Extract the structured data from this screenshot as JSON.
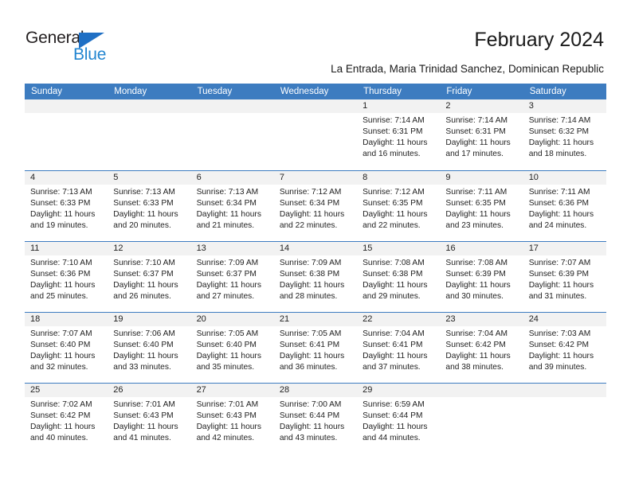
{
  "brand": {
    "name_top": "General",
    "name_bottom": "Blue",
    "accent_color": "#2285d0",
    "triangle_color": "#1f6fc4"
  },
  "header": {
    "title": "February 2024",
    "subtitle": "La Entrada, Maria Trinidad Sanchez, Dominican Republic"
  },
  "calendar": {
    "header_color": "#3d7cc0",
    "date_band_color": "#f2f2f2",
    "day_names": [
      "Sunday",
      "Monday",
      "Tuesday",
      "Wednesday",
      "Thursday",
      "Friday",
      "Saturday"
    ],
    "weeks": [
      [
        {
          "date": "",
          "empty": true
        },
        {
          "date": "",
          "empty": true
        },
        {
          "date": "",
          "empty": true
        },
        {
          "date": "",
          "empty": true
        },
        {
          "date": "1",
          "sunrise": "Sunrise: 7:14 AM",
          "sunset": "Sunset: 6:31 PM",
          "daylight_1": "Daylight: 11 hours",
          "daylight_2": "and 16 minutes."
        },
        {
          "date": "2",
          "sunrise": "Sunrise: 7:14 AM",
          "sunset": "Sunset: 6:31 PM",
          "daylight_1": "Daylight: 11 hours",
          "daylight_2": "and 17 minutes."
        },
        {
          "date": "3",
          "sunrise": "Sunrise: 7:14 AM",
          "sunset": "Sunset: 6:32 PM",
          "daylight_1": "Daylight: 11 hours",
          "daylight_2": "and 18 minutes."
        }
      ],
      [
        {
          "date": "4",
          "sunrise": "Sunrise: 7:13 AM",
          "sunset": "Sunset: 6:33 PM",
          "daylight_1": "Daylight: 11 hours",
          "daylight_2": "and 19 minutes."
        },
        {
          "date": "5",
          "sunrise": "Sunrise: 7:13 AM",
          "sunset": "Sunset: 6:33 PM",
          "daylight_1": "Daylight: 11 hours",
          "daylight_2": "and 20 minutes."
        },
        {
          "date": "6",
          "sunrise": "Sunrise: 7:13 AM",
          "sunset": "Sunset: 6:34 PM",
          "daylight_1": "Daylight: 11 hours",
          "daylight_2": "and 21 minutes."
        },
        {
          "date": "7",
          "sunrise": "Sunrise: 7:12 AM",
          "sunset": "Sunset: 6:34 PM",
          "daylight_1": "Daylight: 11 hours",
          "daylight_2": "and 22 minutes."
        },
        {
          "date": "8",
          "sunrise": "Sunrise: 7:12 AM",
          "sunset": "Sunset: 6:35 PM",
          "daylight_1": "Daylight: 11 hours",
          "daylight_2": "and 22 minutes."
        },
        {
          "date": "9",
          "sunrise": "Sunrise: 7:11 AM",
          "sunset": "Sunset: 6:35 PM",
          "daylight_1": "Daylight: 11 hours",
          "daylight_2": "and 23 minutes."
        },
        {
          "date": "10",
          "sunrise": "Sunrise: 7:11 AM",
          "sunset": "Sunset: 6:36 PM",
          "daylight_1": "Daylight: 11 hours",
          "daylight_2": "and 24 minutes."
        }
      ],
      [
        {
          "date": "11",
          "sunrise": "Sunrise: 7:10 AM",
          "sunset": "Sunset: 6:36 PM",
          "daylight_1": "Daylight: 11 hours",
          "daylight_2": "and 25 minutes."
        },
        {
          "date": "12",
          "sunrise": "Sunrise: 7:10 AM",
          "sunset": "Sunset: 6:37 PM",
          "daylight_1": "Daylight: 11 hours",
          "daylight_2": "and 26 minutes."
        },
        {
          "date": "13",
          "sunrise": "Sunrise: 7:09 AM",
          "sunset": "Sunset: 6:37 PM",
          "daylight_1": "Daylight: 11 hours",
          "daylight_2": "and 27 minutes."
        },
        {
          "date": "14",
          "sunrise": "Sunrise: 7:09 AM",
          "sunset": "Sunset: 6:38 PM",
          "daylight_1": "Daylight: 11 hours",
          "daylight_2": "and 28 minutes."
        },
        {
          "date": "15",
          "sunrise": "Sunrise: 7:08 AM",
          "sunset": "Sunset: 6:38 PM",
          "daylight_1": "Daylight: 11 hours",
          "daylight_2": "and 29 minutes."
        },
        {
          "date": "16",
          "sunrise": "Sunrise: 7:08 AM",
          "sunset": "Sunset: 6:39 PM",
          "daylight_1": "Daylight: 11 hours",
          "daylight_2": "and 30 minutes."
        },
        {
          "date": "17",
          "sunrise": "Sunrise: 7:07 AM",
          "sunset": "Sunset: 6:39 PM",
          "daylight_1": "Daylight: 11 hours",
          "daylight_2": "and 31 minutes."
        }
      ],
      [
        {
          "date": "18",
          "sunrise": "Sunrise: 7:07 AM",
          "sunset": "Sunset: 6:40 PM",
          "daylight_1": "Daylight: 11 hours",
          "daylight_2": "and 32 minutes."
        },
        {
          "date": "19",
          "sunrise": "Sunrise: 7:06 AM",
          "sunset": "Sunset: 6:40 PM",
          "daylight_1": "Daylight: 11 hours",
          "daylight_2": "and 33 minutes."
        },
        {
          "date": "20",
          "sunrise": "Sunrise: 7:05 AM",
          "sunset": "Sunset: 6:40 PM",
          "daylight_1": "Daylight: 11 hours",
          "daylight_2": "and 35 minutes."
        },
        {
          "date": "21",
          "sunrise": "Sunrise: 7:05 AM",
          "sunset": "Sunset: 6:41 PM",
          "daylight_1": "Daylight: 11 hours",
          "daylight_2": "and 36 minutes."
        },
        {
          "date": "22",
          "sunrise": "Sunrise: 7:04 AM",
          "sunset": "Sunset: 6:41 PM",
          "daylight_1": "Daylight: 11 hours",
          "daylight_2": "and 37 minutes."
        },
        {
          "date": "23",
          "sunrise": "Sunrise: 7:04 AM",
          "sunset": "Sunset: 6:42 PM",
          "daylight_1": "Daylight: 11 hours",
          "daylight_2": "and 38 minutes."
        },
        {
          "date": "24",
          "sunrise": "Sunrise: 7:03 AM",
          "sunset": "Sunset: 6:42 PM",
          "daylight_1": "Daylight: 11 hours",
          "daylight_2": "and 39 minutes."
        }
      ],
      [
        {
          "date": "25",
          "sunrise": "Sunrise: 7:02 AM",
          "sunset": "Sunset: 6:42 PM",
          "daylight_1": "Daylight: 11 hours",
          "daylight_2": "and 40 minutes."
        },
        {
          "date": "26",
          "sunrise": "Sunrise: 7:01 AM",
          "sunset": "Sunset: 6:43 PM",
          "daylight_1": "Daylight: 11 hours",
          "daylight_2": "and 41 minutes."
        },
        {
          "date": "27",
          "sunrise": "Sunrise: 7:01 AM",
          "sunset": "Sunset: 6:43 PM",
          "daylight_1": "Daylight: 11 hours",
          "daylight_2": "and 42 minutes."
        },
        {
          "date": "28",
          "sunrise": "Sunrise: 7:00 AM",
          "sunset": "Sunset: 6:44 PM",
          "daylight_1": "Daylight: 11 hours",
          "daylight_2": "and 43 minutes."
        },
        {
          "date": "29",
          "sunrise": "Sunrise: 6:59 AM",
          "sunset": "Sunset: 6:44 PM",
          "daylight_1": "Daylight: 11 hours",
          "daylight_2": "and 44 minutes."
        },
        {
          "date": "",
          "empty": true
        },
        {
          "date": "",
          "empty": true
        }
      ]
    ]
  }
}
